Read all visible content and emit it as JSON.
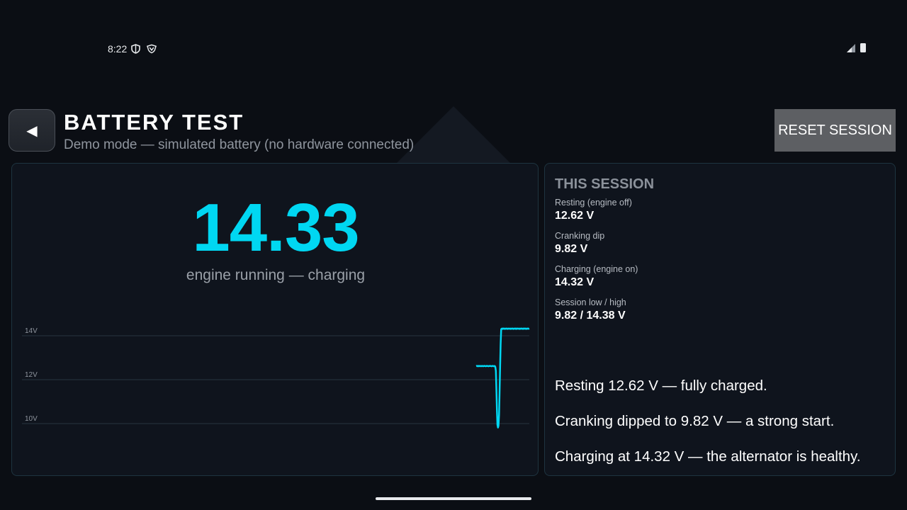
{
  "status_bar": {
    "time": "8:22",
    "left_icons": [
      "shield-icon",
      "shield-check-icon"
    ],
    "right_icons": [
      "signal-icon",
      "battery-icon"
    ]
  },
  "header": {
    "back_label": "◀",
    "title": "BATTERY TEST",
    "subtitle": "Demo mode — simulated battery (no hardware connected)",
    "reset_label": "RESET SESSION"
  },
  "live": {
    "voltage": "14.33",
    "status": "engine running — charging"
  },
  "session": {
    "title": "THIS SESSION",
    "stats": [
      {
        "label": "Resting (engine off)",
        "value": "12.62 V"
      },
      {
        "label": "Cranking dip",
        "value": "9.82 V"
      },
      {
        "label": "Charging (engine on)",
        "value": "14.32 V"
      },
      {
        "label": "Session low / high",
        "value": "9.82 / 14.38 V"
      }
    ],
    "summary": [
      "Resting 12.62 V — fully charged.",
      "Cranking dipped to 9.82 V — a strong start.",
      "Charging at 14.32 V — the alternator is healthy."
    ]
  },
  "colors": {
    "accent": "#00d7f2",
    "background": "#0b0e14",
    "panel": "#0f141d",
    "panel_border": "#1e3440"
  },
  "chart_data": {
    "type": "line",
    "title": "",
    "xlabel": "",
    "ylabel": "",
    "y_ticks": [
      "14V",
      "12V",
      "10V"
    ],
    "y_tick_values": [
      14,
      12,
      10
    ],
    "ylim": [
      9.8,
      14.3
    ],
    "grid": true,
    "series": [
      {
        "color": "#00d7f2",
        "points": [
          [
            0.0,
            12.62
          ],
          [
            0.01,
            12.63
          ],
          [
            0.02,
            12.61
          ],
          [
            0.03,
            12.62
          ],
          [
            0.04,
            12.63
          ],
          [
            0.05,
            12.61
          ],
          [
            0.06,
            12.62
          ],
          [
            0.07,
            12.63
          ],
          [
            0.08,
            12.62
          ],
          [
            0.09,
            12.61
          ],
          [
            0.1,
            12.62
          ],
          [
            0.11,
            12.63
          ],
          [
            0.12,
            12.62
          ],
          [
            0.13,
            12.61
          ],
          [
            0.14,
            12.62
          ],
          [
            0.15,
            12.63
          ],
          [
            0.16,
            12.62
          ],
          [
            0.17,
            12.62
          ],
          [
            0.18,
            12.61
          ],
          [
            0.19,
            12.62
          ],
          [
            0.2,
            12.63
          ],
          [
            0.21,
            12.62
          ],
          [
            0.22,
            12.62
          ],
          [
            0.23,
            12.61
          ],
          [
            0.24,
            12.62
          ],
          [
            0.25,
            12.62
          ],
          [
            0.26,
            12.63
          ],
          [
            0.27,
            12.62
          ],
          [
            0.28,
            12.62
          ],
          [
            0.29,
            12.61
          ],
          [
            0.3,
            12.62
          ],
          [
            0.31,
            12.63
          ],
          [
            0.32,
            12.62
          ],
          [
            0.33,
            12.61
          ],
          [
            0.34,
            12.62
          ],
          [
            0.35,
            12.62
          ],
          [
            0.36,
            12.58
          ],
          [
            0.37,
            12.4
          ],
          [
            0.38,
            11.6
          ],
          [
            0.39,
            10.6
          ],
          [
            0.4,
            9.95
          ],
          [
            0.41,
            9.82
          ],
          [
            0.42,
            9.9
          ],
          [
            0.43,
            10.4
          ],
          [
            0.44,
            11.4
          ],
          [
            0.45,
            12.6
          ],
          [
            0.46,
            13.6
          ],
          [
            0.47,
            14.3
          ],
          [
            0.48,
            14.32
          ],
          [
            0.49,
            14.33
          ],
          [
            0.5,
            14.31
          ],
          [
            0.51,
            14.33
          ],
          [
            0.52,
            14.32
          ],
          [
            0.53,
            14.33
          ],
          [
            0.54,
            14.31
          ],
          [
            0.55,
            14.32
          ],
          [
            0.56,
            14.33
          ],
          [
            0.57,
            14.32
          ],
          [
            0.58,
            14.33
          ],
          [
            0.59,
            14.31
          ],
          [
            0.6,
            14.32
          ],
          [
            0.61,
            14.33
          ],
          [
            0.62,
            14.32
          ],
          [
            0.63,
            14.32
          ],
          [
            0.64,
            14.33
          ],
          [
            0.65,
            14.31
          ],
          [
            0.66,
            14.32
          ],
          [
            0.67,
            14.33
          ],
          [
            0.68,
            14.32
          ],
          [
            0.69,
            14.33
          ],
          [
            0.7,
            14.31
          ],
          [
            0.71,
            14.32
          ],
          [
            0.72,
            14.33
          ],
          [
            0.73,
            14.32
          ],
          [
            0.74,
            14.33
          ],
          [
            0.75,
            14.31
          ],
          [
            0.76,
            14.33
          ],
          [
            0.77,
            14.32
          ],
          [
            0.78,
            14.33
          ],
          [
            0.79,
            14.32
          ],
          [
            0.8,
            14.32
          ],
          [
            0.81,
            14.33
          ],
          [
            0.82,
            14.31
          ],
          [
            0.83,
            14.32
          ],
          [
            0.84,
            14.33
          ],
          [
            0.85,
            14.32
          ],
          [
            0.86,
            14.33
          ],
          [
            0.87,
            14.32
          ],
          [
            0.88,
            14.31
          ],
          [
            0.89,
            14.33
          ],
          [
            0.9,
            14.32
          ],
          [
            0.91,
            14.33
          ],
          [
            0.92,
            14.32
          ],
          [
            0.93,
            14.33
          ],
          [
            0.94,
            14.31
          ],
          [
            0.95,
            14.32
          ],
          [
            0.96,
            14.33
          ],
          [
            0.97,
            14.32
          ],
          [
            0.98,
            14.33
          ],
          [
            0.99,
            14.32
          ],
          [
            1.0,
            14.33
          ]
        ]
      }
    ]
  }
}
